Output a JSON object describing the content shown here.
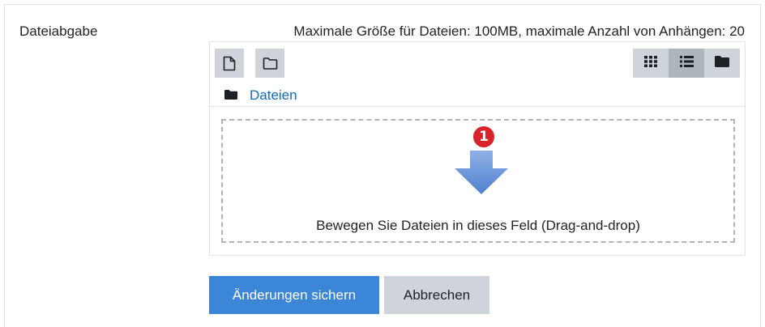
{
  "field": {
    "label": "Dateiabgabe",
    "limits": "Maximale Größe für Dateien: 100MB, maximale Anzahl von Anhängen: 20"
  },
  "filemanager": {
    "toolbar": {
      "add_file_icon": "file-icon",
      "add_folder_icon": "folder-outline-icon",
      "views": [
        {
          "icon": "grid-icon",
          "active": false
        },
        {
          "icon": "list-icon",
          "active": true
        },
        {
          "icon": "folder-icon",
          "active": false
        }
      ]
    },
    "path": {
      "icon": "folder-icon",
      "label": "Dateien"
    },
    "dropzone": {
      "badge": "1",
      "arrow_icon": "down-arrow-icon",
      "text": "Bewegen Sie Dateien in dieses Feld (Drag-and-drop)"
    }
  },
  "actions": {
    "save_label": "Änderungen sichern",
    "cancel_label": "Abbrechen"
  },
  "colors": {
    "primary": "#3c86d8",
    "link": "#0f6cbf",
    "badge": "#d9232a",
    "button_grey": "#ced4da"
  }
}
